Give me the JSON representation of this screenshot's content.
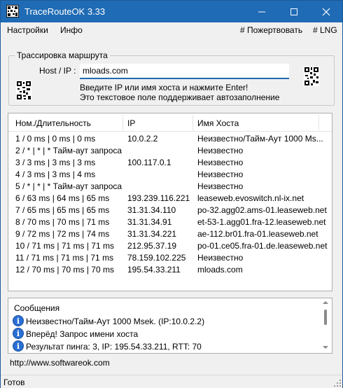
{
  "window": {
    "title": "TraceRouteOK 3.33"
  },
  "menu": {
    "settings": "Настройки",
    "info": "Инфо",
    "donate": "# Пожертвовать",
    "lng": "# LNG"
  },
  "trace": {
    "group_title": "Трассировка маршрута",
    "host_label": "Host / IP :",
    "host_value": "mloads.com",
    "hint1": "Введите IP или имя хоста и нажмите Enter!",
    "hint2": "Это текстовое поле поддерживает автозаполнение"
  },
  "table": {
    "headers": [
      "Ном./Длительность",
      "IP",
      "Имя Хоста"
    ],
    "rows": [
      [
        "1 / 0 ms | 0 ms | 0 ms",
        "10.0.2.2",
        "Неизвестно/Тайм-Аут 1000 Ms..."
      ],
      [
        "2 / * | * | * Тайм-аут запроса",
        "",
        "Неизвестно"
      ],
      [
        "3 / 3 ms | 3 ms | 3 ms",
        "100.117.0.1",
        "Неизвестно"
      ],
      [
        "4 / 3 ms | 3 ms | 4 ms",
        "",
        "Неизвестно"
      ],
      [
        "5 / * | * | * Тайм-аут запроса",
        "",
        "Неизвестно"
      ],
      [
        "6 / 63 ms | 64 ms | 65 ms",
        "193.239.116.221",
        "leaseweb.evoswitch.nl-ix.net"
      ],
      [
        "7 / 65 ms | 65 ms | 65 ms",
        "31.31.34.110",
        "po-32.agg02.ams-01.leaseweb.net"
      ],
      [
        "8 / 70 ms | 70 ms | 71 ms",
        "31.31.34.91",
        "et-53-1.agg01.fra-12.leaseweb.net"
      ],
      [
        "9 / 72 ms | 72 ms | 74 ms",
        "31.31.34.221",
        "ae-112.br01.fra-01.leaseweb.net"
      ],
      [
        "10 / 71 ms | 71 ms | 71 ms",
        "212.95.37.19",
        "po-01.ce05.fra-01.de.leaseweb.net"
      ],
      [
        "11 / 71 ms | 71 ms | 71 ms",
        "78.159.102.225",
        "Неизвестно"
      ],
      [
        "12 / 70 ms | 70 ms | 70 ms",
        "195.54.33.211",
        "mloads.com"
      ]
    ]
  },
  "messages": {
    "title": "Сообщения",
    "items": [
      "Неизвестно/Тайм-Аут 1000 Msek. (IP:10.0.2.2)",
      "Вперёд! Запрос имени хоста",
      "Результат пинга: 3, IP: 195.54.33.211, RTT: 70"
    ]
  },
  "footer": {
    "url": "http://www.softwareok.com"
  },
  "status": {
    "text": "Готов"
  },
  "colors": {
    "titlebar": "#1f6bb5",
    "info_icon": "#2a6fd3"
  }
}
